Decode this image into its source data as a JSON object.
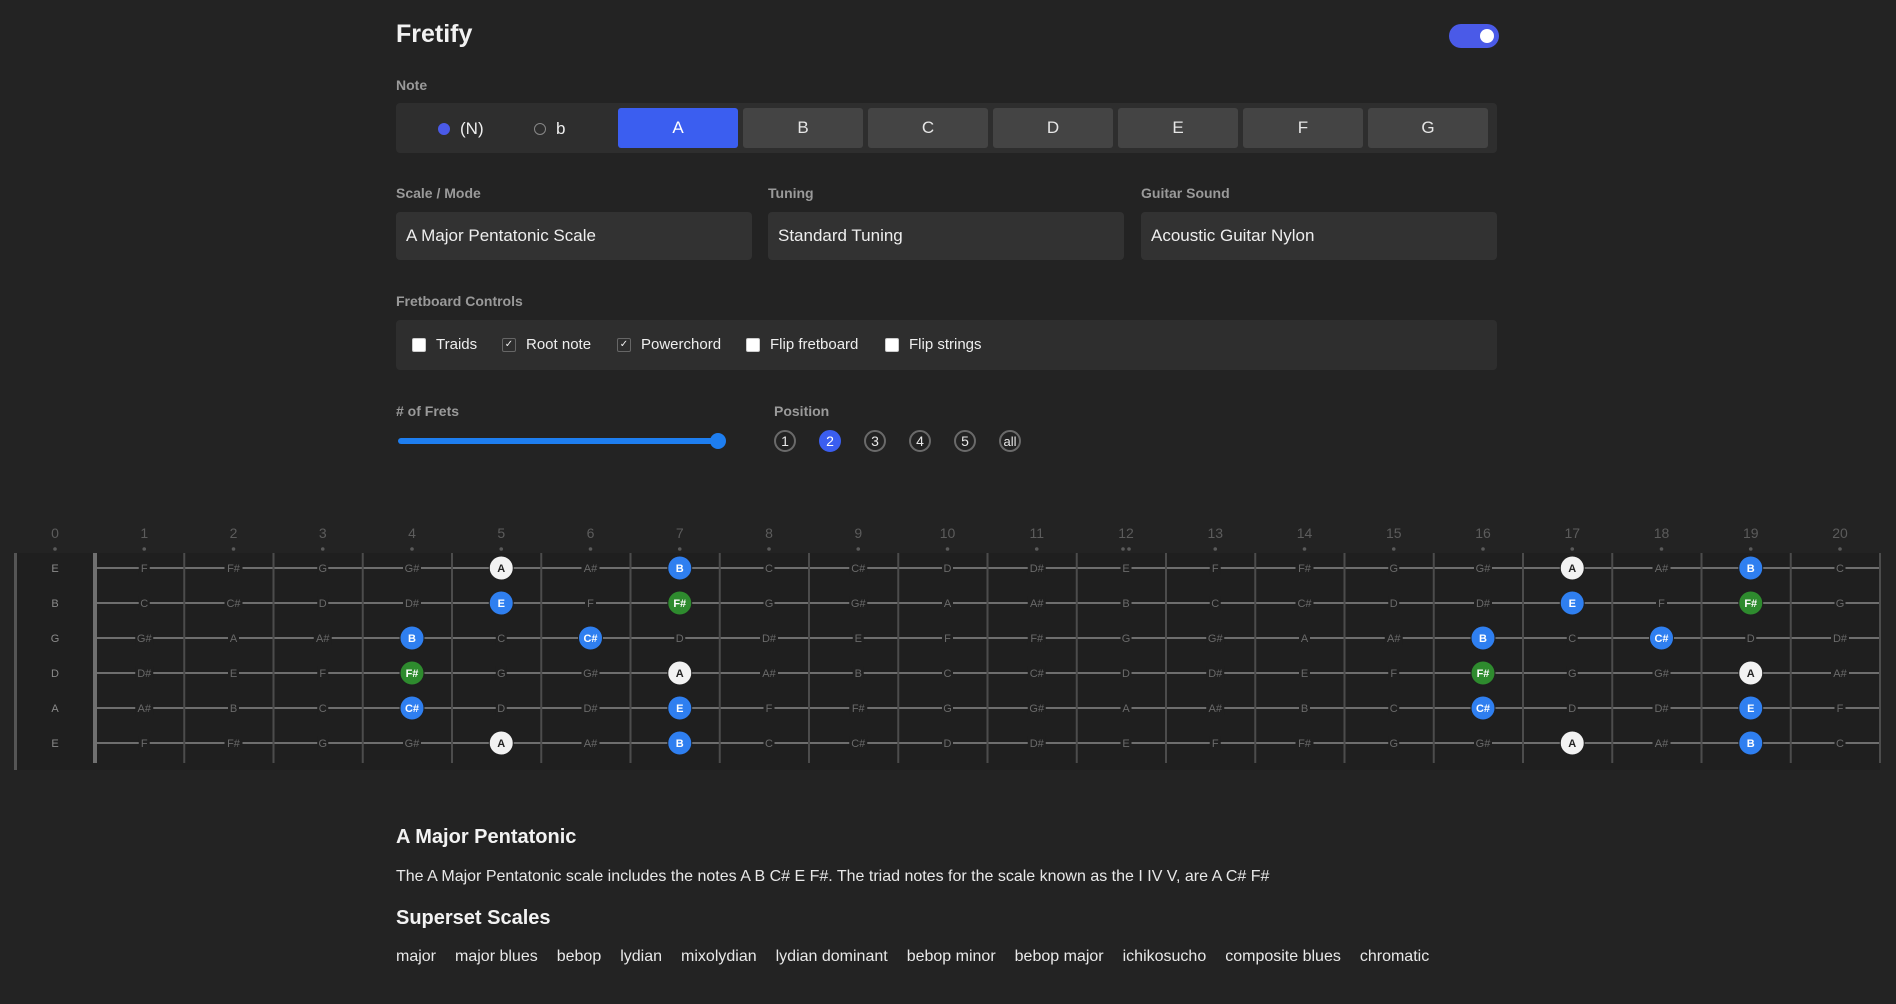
{
  "header": {
    "title": "Fretify",
    "toggle_on": true
  },
  "note": {
    "label": "Note",
    "accidentals": [
      {
        "label": "(N)",
        "selected": true
      },
      {
        "label": "b",
        "selected": false
      }
    ],
    "buttons": [
      "A",
      "B",
      "C",
      "D",
      "E",
      "F",
      "G"
    ],
    "selected": "A"
  },
  "selects": {
    "scale": {
      "label": "Scale / Mode",
      "value": "A Major Pentatonic Scale"
    },
    "tuning": {
      "label": "Tuning",
      "value": "Standard Tuning"
    },
    "sound": {
      "label": "Guitar Sound",
      "value": "Acoustic Guitar Nylon"
    }
  },
  "controls": {
    "label": "Fretboard Controls",
    "items": [
      {
        "label": "Traids",
        "checked": false
      },
      {
        "label": "Root note",
        "checked": true
      },
      {
        "label": "Powerchord",
        "checked": true
      },
      {
        "label": "Flip fretboard",
        "checked": false
      },
      {
        "label": "Flip strings",
        "checked": false
      }
    ]
  },
  "frets": {
    "label": "# of Frets",
    "value_fraction": 1.0
  },
  "position": {
    "label": "Position",
    "options": [
      "1",
      "2",
      "3",
      "4",
      "5",
      "all"
    ],
    "selected": "2"
  },
  "fretboard": {
    "fret_numbers": [
      "0",
      "1",
      "2",
      "3",
      "4",
      "5",
      "6",
      "7",
      "8",
      "9",
      "10",
      "11",
      "12",
      "13",
      "14",
      "15",
      "16",
      "17",
      "18",
      "19",
      "20"
    ],
    "strings": [
      "E",
      "B",
      "G",
      "D",
      "A",
      "E"
    ],
    "note_names": [
      [
        "F",
        "F#",
        "G",
        "G#",
        "A",
        "A#",
        "B",
        "C",
        "C#",
        "D",
        "D#",
        "E",
        "F",
        "F#",
        "G",
        "G#",
        "A",
        "A#",
        "B",
        "C"
      ],
      [
        "C",
        "C#",
        "D",
        "D#",
        "E",
        "F",
        "F#",
        "G",
        "G#",
        "A",
        "A#",
        "B",
        "C",
        "C#",
        "D",
        "D#",
        "E",
        "F",
        "F#",
        "G"
      ],
      [
        "G#",
        "A",
        "A#",
        "B",
        "C",
        "C#",
        "D",
        "D#",
        "E",
        "F",
        "F#",
        "G",
        "G#",
        "A",
        "A#",
        "B",
        "C",
        "C#",
        "D",
        "D#"
      ],
      [
        "D#",
        "E",
        "F",
        "F#",
        "G",
        "G#",
        "A",
        "A#",
        "B",
        "C",
        "C#",
        "D",
        "D#",
        "E",
        "F",
        "F#",
        "G",
        "G#",
        "A",
        "A#"
      ],
      [
        "A#",
        "B",
        "C",
        "C#",
        "D",
        "D#",
        "E",
        "F",
        "F#",
        "G",
        "G#",
        "A",
        "A#",
        "B",
        "C",
        "C#",
        "D",
        "D#",
        "E",
        "F"
      ],
      [
        "F",
        "F#",
        "G",
        "G#",
        "A",
        "A#",
        "B",
        "C",
        "C#",
        "D",
        "D#",
        "E",
        "F",
        "F#",
        "G",
        "G#",
        "A",
        "A#",
        "B",
        "C"
      ]
    ],
    "highlights": [
      {
        "string": 0,
        "fret": 5,
        "kind": "root"
      },
      {
        "string": 0,
        "fret": 7,
        "kind": "scale"
      },
      {
        "string": 0,
        "fret": 17,
        "kind": "root"
      },
      {
        "string": 0,
        "fret": 19,
        "kind": "scale"
      },
      {
        "string": 1,
        "fret": 5,
        "kind": "scale"
      },
      {
        "string": 1,
        "fret": 7,
        "kind": "power"
      },
      {
        "string": 1,
        "fret": 17,
        "kind": "scale"
      },
      {
        "string": 1,
        "fret": 19,
        "kind": "power"
      },
      {
        "string": 2,
        "fret": 4,
        "kind": "scale"
      },
      {
        "string": 2,
        "fret": 6,
        "kind": "scale"
      },
      {
        "string": 2,
        "fret": 16,
        "kind": "scale"
      },
      {
        "string": 2,
        "fret": 18,
        "kind": "scale"
      },
      {
        "string": 3,
        "fret": 4,
        "kind": "power"
      },
      {
        "string": 3,
        "fret": 7,
        "kind": "root"
      },
      {
        "string": 3,
        "fret": 16,
        "kind": "power"
      },
      {
        "string": 3,
        "fret": 19,
        "kind": "root"
      },
      {
        "string": 4,
        "fret": 4,
        "kind": "scale"
      },
      {
        "string": 4,
        "fret": 7,
        "kind": "scale"
      },
      {
        "string": 4,
        "fret": 16,
        "kind": "scale"
      },
      {
        "string": 4,
        "fret": 19,
        "kind": "scale"
      },
      {
        "string": 5,
        "fret": 5,
        "kind": "root"
      },
      {
        "string": 5,
        "fret": 7,
        "kind": "scale"
      },
      {
        "string": 5,
        "fret": 17,
        "kind": "root"
      },
      {
        "string": 5,
        "fret": 19,
        "kind": "scale"
      }
    ],
    "colors": {
      "root": "#f2f2f2",
      "scale": "#2f7ff0",
      "power": "#2e8b2e"
    }
  },
  "info": {
    "title": "A Major Pentatonic",
    "description": "The A Major Pentatonic scale includes the notes A B C# E F#. The triad notes for the scale known as the I IV V, are A C# F#",
    "superset_title": "Superset Scales",
    "superset": [
      "major",
      "major blues",
      "bebop",
      "lydian",
      "mixolydian",
      "lydian dominant",
      "bebop minor",
      "bebop major",
      "ichikosucho",
      "composite blues",
      "chromatic"
    ]
  }
}
